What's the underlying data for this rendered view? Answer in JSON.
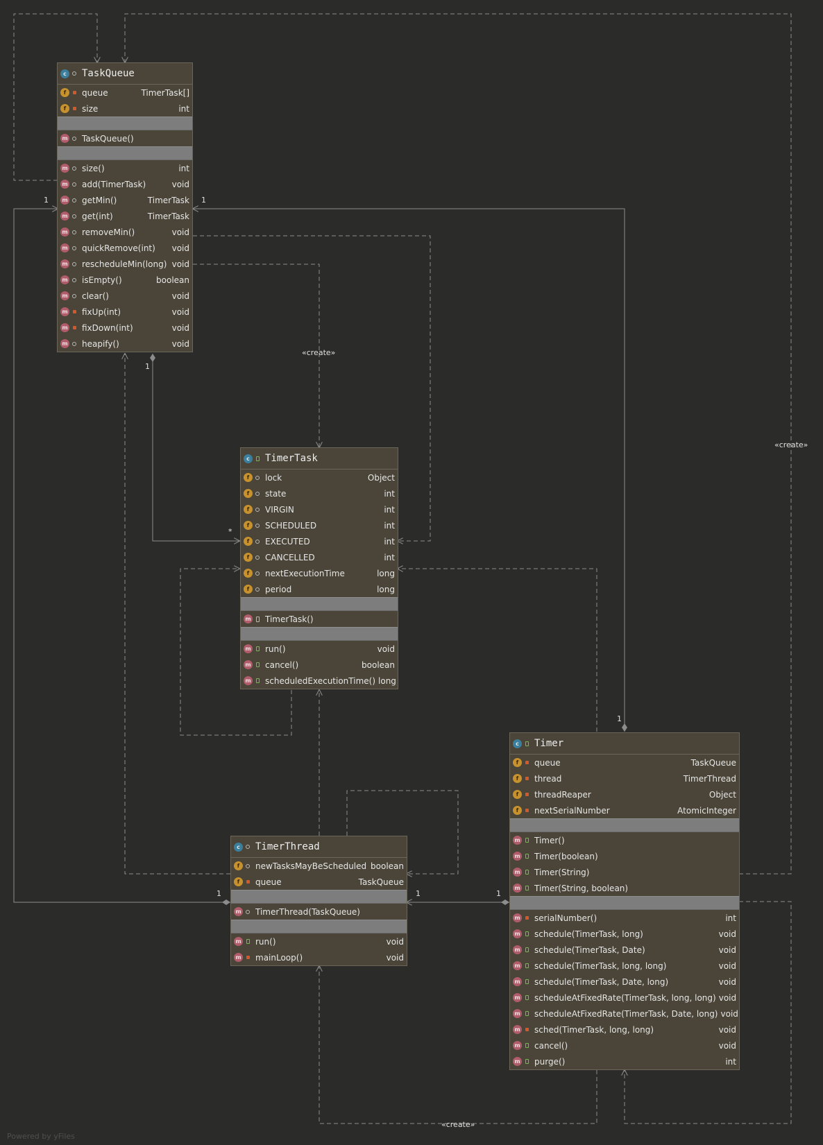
{
  "diagram": {
    "classes": [
      {
        "id": "taskqueue",
        "name": "TaskQueue",
        "icon": "class-icon",
        "visibility": "package",
        "fields": [
          {
            "name": "queue",
            "type": "TimerTask[]",
            "visibility": "private"
          },
          {
            "name": "size",
            "type": "int",
            "visibility": "private"
          }
        ],
        "constructors": [
          {
            "name": "TaskQueue()",
            "type": "",
            "visibility": "package"
          }
        ],
        "methods": [
          {
            "name": "size()",
            "type": "int",
            "visibility": "package"
          },
          {
            "name": "add(TimerTask)",
            "type": "void",
            "visibility": "package"
          },
          {
            "name": "getMin()",
            "type": "TimerTask",
            "visibility": "package"
          },
          {
            "name": "get(int)",
            "type": "TimerTask",
            "visibility": "package"
          },
          {
            "name": "removeMin()",
            "type": "void",
            "visibility": "package"
          },
          {
            "name": "quickRemove(int)",
            "type": "void",
            "visibility": "package"
          },
          {
            "name": "rescheduleMin(long)",
            "type": "void",
            "visibility": "package"
          },
          {
            "name": "isEmpty()",
            "type": "boolean",
            "visibility": "package"
          },
          {
            "name": "clear()",
            "type": "void",
            "visibility": "package"
          },
          {
            "name": "fixUp(int)",
            "type": "void",
            "visibility": "private"
          },
          {
            "name": "fixDown(int)",
            "type": "void",
            "visibility": "private"
          },
          {
            "name": "heapify()",
            "type": "void",
            "visibility": "package"
          }
        ]
      },
      {
        "id": "timertask",
        "name": "TimerTask",
        "icon": "abstract-class-icon",
        "visibility": "public",
        "fields": [
          {
            "name": "lock",
            "type": "Object",
            "visibility": "package"
          },
          {
            "name": "state",
            "type": "int",
            "visibility": "package"
          },
          {
            "name": "VIRGIN",
            "type": "int",
            "visibility": "package"
          },
          {
            "name": "SCHEDULED",
            "type": "int",
            "visibility": "package"
          },
          {
            "name": "EXECUTED",
            "type": "int",
            "visibility": "package"
          },
          {
            "name": "CANCELLED",
            "type": "int",
            "visibility": "package"
          },
          {
            "name": "nextExecutionTime",
            "type": "long",
            "visibility": "package"
          },
          {
            "name": "period",
            "type": "long",
            "visibility": "package"
          }
        ],
        "constructors": [
          {
            "name": "TimerTask()",
            "type": "",
            "visibility": "protected"
          }
        ],
        "methods": [
          {
            "name": "run()",
            "type": "void",
            "visibility": "public"
          },
          {
            "name": "cancel()",
            "type": "boolean",
            "visibility": "public"
          },
          {
            "name": "scheduledExecutionTime()",
            "type": "long",
            "visibility": "public"
          }
        ]
      },
      {
        "id": "timer",
        "name": "Timer",
        "icon": "class-icon",
        "visibility": "public",
        "fields": [
          {
            "name": "queue",
            "type": "TaskQueue",
            "visibility": "private"
          },
          {
            "name": "thread",
            "type": "TimerThread",
            "visibility": "private"
          },
          {
            "name": "threadReaper",
            "type": "Object",
            "visibility": "private"
          },
          {
            "name": "nextSerialNumber",
            "type": "AtomicInteger",
            "visibility": "private"
          }
        ],
        "constructors": [
          {
            "name": "Timer()",
            "type": "",
            "visibility": "public"
          },
          {
            "name": "Timer(boolean)",
            "type": "",
            "visibility": "public"
          },
          {
            "name": "Timer(String)",
            "type": "",
            "visibility": "public"
          },
          {
            "name": "Timer(String, boolean)",
            "type": "",
            "visibility": "public"
          }
        ],
        "methods": [
          {
            "name": "serialNumber()",
            "type": "int",
            "visibility": "private"
          },
          {
            "name": "schedule(TimerTask, long)",
            "type": "void",
            "visibility": "public"
          },
          {
            "name": "schedule(TimerTask, Date)",
            "type": "void",
            "visibility": "public"
          },
          {
            "name": "schedule(TimerTask, long, long)",
            "type": "void",
            "visibility": "public"
          },
          {
            "name": "schedule(TimerTask, Date, long)",
            "type": "void",
            "visibility": "public"
          },
          {
            "name": "scheduleAtFixedRate(TimerTask, long, long)",
            "type": "void",
            "visibility": "public"
          },
          {
            "name": "scheduleAtFixedRate(TimerTask, Date, long)",
            "type": "void",
            "visibility": "public"
          },
          {
            "name": "sched(TimerTask, long, long)",
            "type": "void",
            "visibility": "private"
          },
          {
            "name": "cancel()",
            "type": "void",
            "visibility": "public"
          },
          {
            "name": "purge()",
            "type": "int",
            "visibility": "public"
          }
        ]
      },
      {
        "id": "timerthread",
        "name": "TimerThread",
        "icon": "class-icon",
        "visibility": "package",
        "fields": [
          {
            "name": "newTasksMayBeScheduled",
            "type": "boolean",
            "visibility": "package"
          },
          {
            "name": "queue",
            "type": "TaskQueue",
            "visibility": "private"
          }
        ],
        "constructors": [
          {
            "name": "TimerThread(TaskQueue)",
            "type": "",
            "visibility": "package"
          }
        ],
        "methods": [
          {
            "name": "run()",
            "type": "void",
            "visibility": "public"
          },
          {
            "name": "mainLoop()",
            "type": "void",
            "visibility": "private"
          }
        ]
      }
    ],
    "edge_labels": {
      "create_1": "«create»",
      "create_2": "«create»",
      "create_3": "«create»",
      "m_tq_left": "1",
      "m_tq_right": "1",
      "m_tq_bottom": "1",
      "m_tt_many": "*",
      "m_timer_top": "1",
      "m_thread_left": "1",
      "m_thread_right": "1",
      "m_timer_left": "1"
    },
    "footer": "Powered by yFiles",
    "colors": {
      "background": "#2b2b29",
      "node_fill": "#4a4538",
      "separator": "#7d7d7d",
      "edge": "#8c8c8c",
      "field_icon": "#c7922e",
      "method_icon": "#b05c6a",
      "class_icon": "#3c7f9c"
    }
  }
}
